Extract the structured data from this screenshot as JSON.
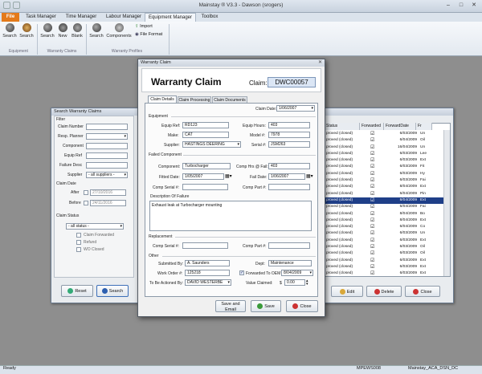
{
  "app": {
    "title": "Mainstay ® V3.3 - Dawson (srogers)",
    "minimize": "–",
    "maximize": "□",
    "close": "✕"
  },
  "tabs": [
    {
      "label": "File"
    },
    {
      "label": "Task Manager"
    },
    {
      "label": "Time Manager"
    },
    {
      "label": "Labour Manager"
    },
    {
      "label": "Equipment Manager"
    },
    {
      "label": "Toolbox"
    }
  ],
  "ribbon": {
    "buttons": [
      "Search",
      "Search",
      "Search",
      "New",
      "Blank",
      "Search",
      "Components",
      "Import",
      "File Format"
    ],
    "groups": [
      "Equipment",
      "Warranty Claims",
      "Warranty Profiles"
    ]
  },
  "search_window": {
    "title": "Search Warranty Claims",
    "filter_label": "Filter",
    "fields": [
      "Claim Number",
      "Resp. Planner",
      "Component",
      "Equip Ref",
      "Failure Desc",
      "Supplier"
    ],
    "supplier_value": "- all suppliers -",
    "claim_date_label": "Claim Date",
    "after_label": "After",
    "after_value": "27/10/2016",
    "before_label": "Before",
    "before_value": "24/11/2016",
    "claim_status_label": "Claim Status",
    "status_value": "- all status -",
    "checks": [
      "Claim Forwarded",
      "Refund",
      "WO Closed"
    ],
    "reset": "Reset",
    "search": "Search",
    "columns": [
      "Status",
      "Forwarded",
      "ForwardDate",
      "Fr"
    ],
    "rows": [
      {
        "status": "proved (closed)",
        "date": "6/03/2009",
        "fr": "Un"
      },
      {
        "status": "proved (closed)",
        "date": "6/04/2009",
        "fr": "Oil"
      },
      {
        "status": "proved (closed)",
        "date": "16/04/2009",
        "fr": "Un"
      },
      {
        "status": "proved (closed)",
        "date": "6/03/2009",
        "fr": "Lee"
      },
      {
        "status": "proved (closed)",
        "date": "6/03/2009",
        "fr": "Ext"
      },
      {
        "status": "proved (closed)",
        "date": "6/03/2009",
        "fr": "Fit"
      },
      {
        "status": "proved (closed)",
        "date": "6/03/2009",
        "fr": "Hy"
      },
      {
        "status": "proved (closed)",
        "date": "6/03/2009",
        "fr": "Fai"
      },
      {
        "status": "proved (closed)",
        "date": "8/04/2009",
        "fr": "Ext"
      },
      {
        "status": "proved (closed)",
        "date": "6/04/2009",
        "fr": "Pin"
      },
      {
        "status": "proved (closed)",
        "date": "8/04/2009",
        "fr": "Ext",
        "selected": true
      },
      {
        "status": "proved (closed)",
        "date": "6/04/2009",
        "fr": "Fai"
      },
      {
        "status": "proved (closed)",
        "date": "8/04/2009",
        "fr": "Bo"
      },
      {
        "status": "proved (closed)",
        "date": "8/04/2009",
        "fr": "Ext"
      },
      {
        "status": "proved (closed)",
        "date": "6/04/2009",
        "fr": "Co"
      },
      {
        "status": "proved (closed)",
        "date": "6/03/2009",
        "fr": "Un"
      },
      {
        "status": "proved (closed)",
        "date": "6/03/2009",
        "fr": "Ext"
      },
      {
        "status": "proved (closed)",
        "date": "6/03/2009",
        "fr": "Oil"
      },
      {
        "status": "proved (closed)",
        "date": "6/03/2009",
        "fr": "Oil"
      },
      {
        "status": "proved (closed)",
        "date": "6/03/2009",
        "fr": "Ext"
      },
      {
        "status": "proved (closed)",
        "date": "6/03/2009",
        "fr": "Ext"
      },
      {
        "status": "proved (closed)",
        "date": "6/03/2009",
        "fr": "Ext"
      }
    ],
    "edit": "Edit",
    "delete": "Delete",
    "close": "Close"
  },
  "claim": {
    "window_title": "Warranty Claim",
    "heading": "Warranty Claim",
    "claim_label": "Claim:",
    "claim_number": "DWC00057",
    "tabs": [
      "Claim Details",
      "Claim Processing",
      "Claim Documents"
    ],
    "claim_date_label": "Claim Date:",
    "claim_date": "1/06/2007",
    "equipment_section": "Equipment",
    "equip_ref_label": "Equip Ref:",
    "equip_ref": "RD123",
    "make_label": "Make:",
    "make": "CAT",
    "supplier_label": "Supplier:",
    "supplier": "HASTINGS DEERING",
    "equip_hours_label": "Equip Hours:",
    "equip_hours": "403",
    "model_label": "Model #:",
    "model": "7978",
    "serial_label": "Serial #:",
    "serial": "JSM263",
    "failed_section": "Failed Component",
    "component_label": "Component:",
    "component": "Turbocharger",
    "comp_hrs_label": "Comp Hrs @ Fail:",
    "comp_hrs": "403",
    "fitted_label": "Fitted Date:",
    "fitted": "1/05/2007",
    "fail_date_label": "Fail Date:",
    "fail_date": "1/06/2007",
    "comp_serial_label": "Comp Serial #:",
    "comp_part_label": "Comp Part #:",
    "desc_section": "Description Of Failure",
    "description": "Exhaust leak at Turbocharger mounting",
    "replacement_section": "Replacement",
    "rep_serial_label": "Comp Serial #:",
    "rep_part_label": "Comp Part #:",
    "other_section": "Other",
    "submitted_label": "Submitted By:",
    "submitted": "A. Saunders",
    "dept_label": "Dept:",
    "dept": "Maintenance",
    "wo_label": "Work Order #:",
    "wo": "125218",
    "forwarded_label": "Forwarded To OEM",
    "forwarded_date": "8/04/2009",
    "actioned_label": "To Be Actioned By:",
    "actioned": "DAVID WESTERBE",
    "value_label": "Value Claimed:",
    "value_currency": "$",
    "value": "0.00",
    "save_email": "Save and Email",
    "save": "Save",
    "close": "Close"
  },
  "statusbar": {
    "left": "Ready",
    "mid": "MPEWS008",
    "right": "Mainstay_ACA_DSN_DC"
  }
}
